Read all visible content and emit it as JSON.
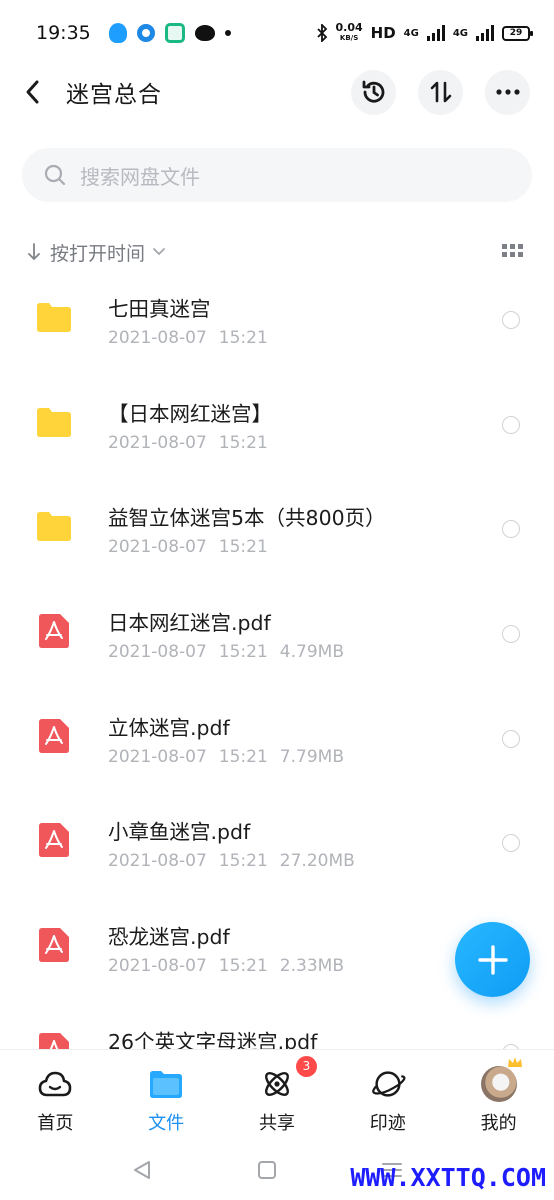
{
  "status_bar": {
    "time": "19:35",
    "speed_value": "0.04",
    "speed_unit": "KB/S",
    "hd_label": "HD",
    "net1": "4G",
    "net2": "4G",
    "battery": "29"
  },
  "header": {
    "title": "迷宫总合"
  },
  "search": {
    "placeholder": "搜索网盘文件"
  },
  "sort": {
    "label": "按打开时间"
  },
  "files": [
    {
      "type": "folder",
      "name": "七田真迷宫",
      "date": "2021-08-07",
      "time": "15:21",
      "size": ""
    },
    {
      "type": "folder",
      "name": "【日本网红迷宫】",
      "date": "2021-08-07",
      "time": "15:21",
      "size": ""
    },
    {
      "type": "folder",
      "name": "益智立体迷宫5本（共800页）",
      "date": "2021-08-07",
      "time": "15:21",
      "size": ""
    },
    {
      "type": "pdf",
      "name": "日本网红迷宫.pdf",
      "date": "2021-08-07",
      "time": "15:21",
      "size": "4.79MB"
    },
    {
      "type": "pdf",
      "name": "立体迷宫.pdf",
      "date": "2021-08-07",
      "time": "15:21",
      "size": "7.79MB"
    },
    {
      "type": "pdf",
      "name": "小章鱼迷宫.pdf",
      "date": "2021-08-07",
      "time": "15:21",
      "size": "27.20MB"
    },
    {
      "type": "pdf",
      "name": "恐龙迷宫.pdf",
      "date": "2021-08-07",
      "time": "15:21",
      "size": "2.33MB"
    },
    {
      "type": "pdf",
      "name": "26个英文字母迷宫.pdf",
      "date": "",
      "time": "",
      "size": ""
    }
  ],
  "bottom_nav": {
    "home": "首页",
    "files": "文件",
    "share": "共享",
    "share_badge": "3",
    "trace": "印迹",
    "mine": "我的"
  },
  "watermark": "WWW.XXTTQ.COM",
  "colors": {
    "accent": "#1a8ff4",
    "folder": "#ffd43b",
    "pdf": "#f0575b",
    "badge": "#ff4a4a",
    "watermark": "#1d1dff"
  }
}
